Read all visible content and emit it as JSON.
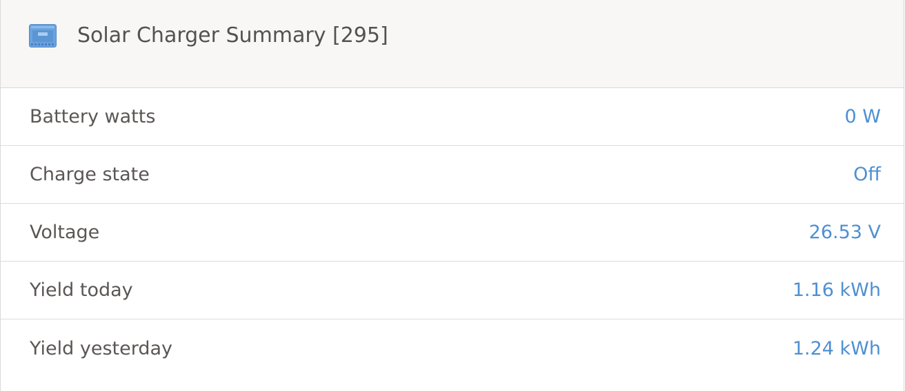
{
  "header": {
    "title": "Solar Charger Summary [295]",
    "icon": "solar-charger-device-icon",
    "icon_color": "#6aa3df"
  },
  "rows": [
    {
      "label": "Battery watts",
      "value": "0 W"
    },
    {
      "label": "Charge state",
      "value": "Off"
    },
    {
      "label": "Voltage",
      "value": "26.53 V"
    },
    {
      "label": "Yield today",
      "value": "1.16 kWh"
    },
    {
      "label": "Yield yesterday",
      "value": "1.24 kWh"
    }
  ],
  "colors": {
    "header_bg": "#f8f7f5",
    "label_text": "#5a5654",
    "value_text": "#4f8fd1",
    "divider": "#dcdcdc"
  }
}
